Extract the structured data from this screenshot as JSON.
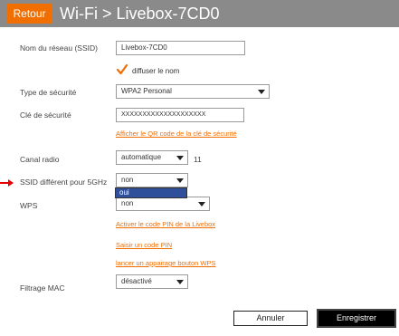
{
  "header": {
    "back_label": "Retour",
    "title": "Wi-Fi > Livebox-7CD0"
  },
  "form": {
    "ssid_label": "Nom du réseau (SSID)",
    "ssid_value": "Livebox-7CD0",
    "broadcast_label": "diffuser le nom",
    "broadcast_checked": true,
    "security_type_label": "Type de sécurité",
    "security_type_value": "WPA2 Personal",
    "security_key_label": "Clé de sécurité",
    "security_key_value": "XXXXXXXXXXXXXXXXXXXX",
    "qr_link": "Afficher le QR code de la clé de sécurité",
    "channel_label": "Canal radio",
    "channel_value": "automatique",
    "channel_number": "11",
    "ssid5_label": "SSID différent pour 5GHz",
    "ssid5_value": "non",
    "ssid5_open_option": "oui",
    "wps_label": "WPS",
    "wps_value": "non",
    "wps_link_pin": "Activer le code PIN de la Livebox",
    "wps_link_enter_pin": "Saisir un code PIN",
    "wps_link_button": "lancer un appairage bouton WPS",
    "mac_filter_label": "Filtrage MAC",
    "mac_filter_value": "désactivé"
  },
  "actions": {
    "cancel_label": "Annuler",
    "save_label": "Enregistrer"
  },
  "colors": {
    "accent": "#f16e00",
    "header_bg": "#8a8a8a",
    "selection": "#2f4f9a"
  }
}
